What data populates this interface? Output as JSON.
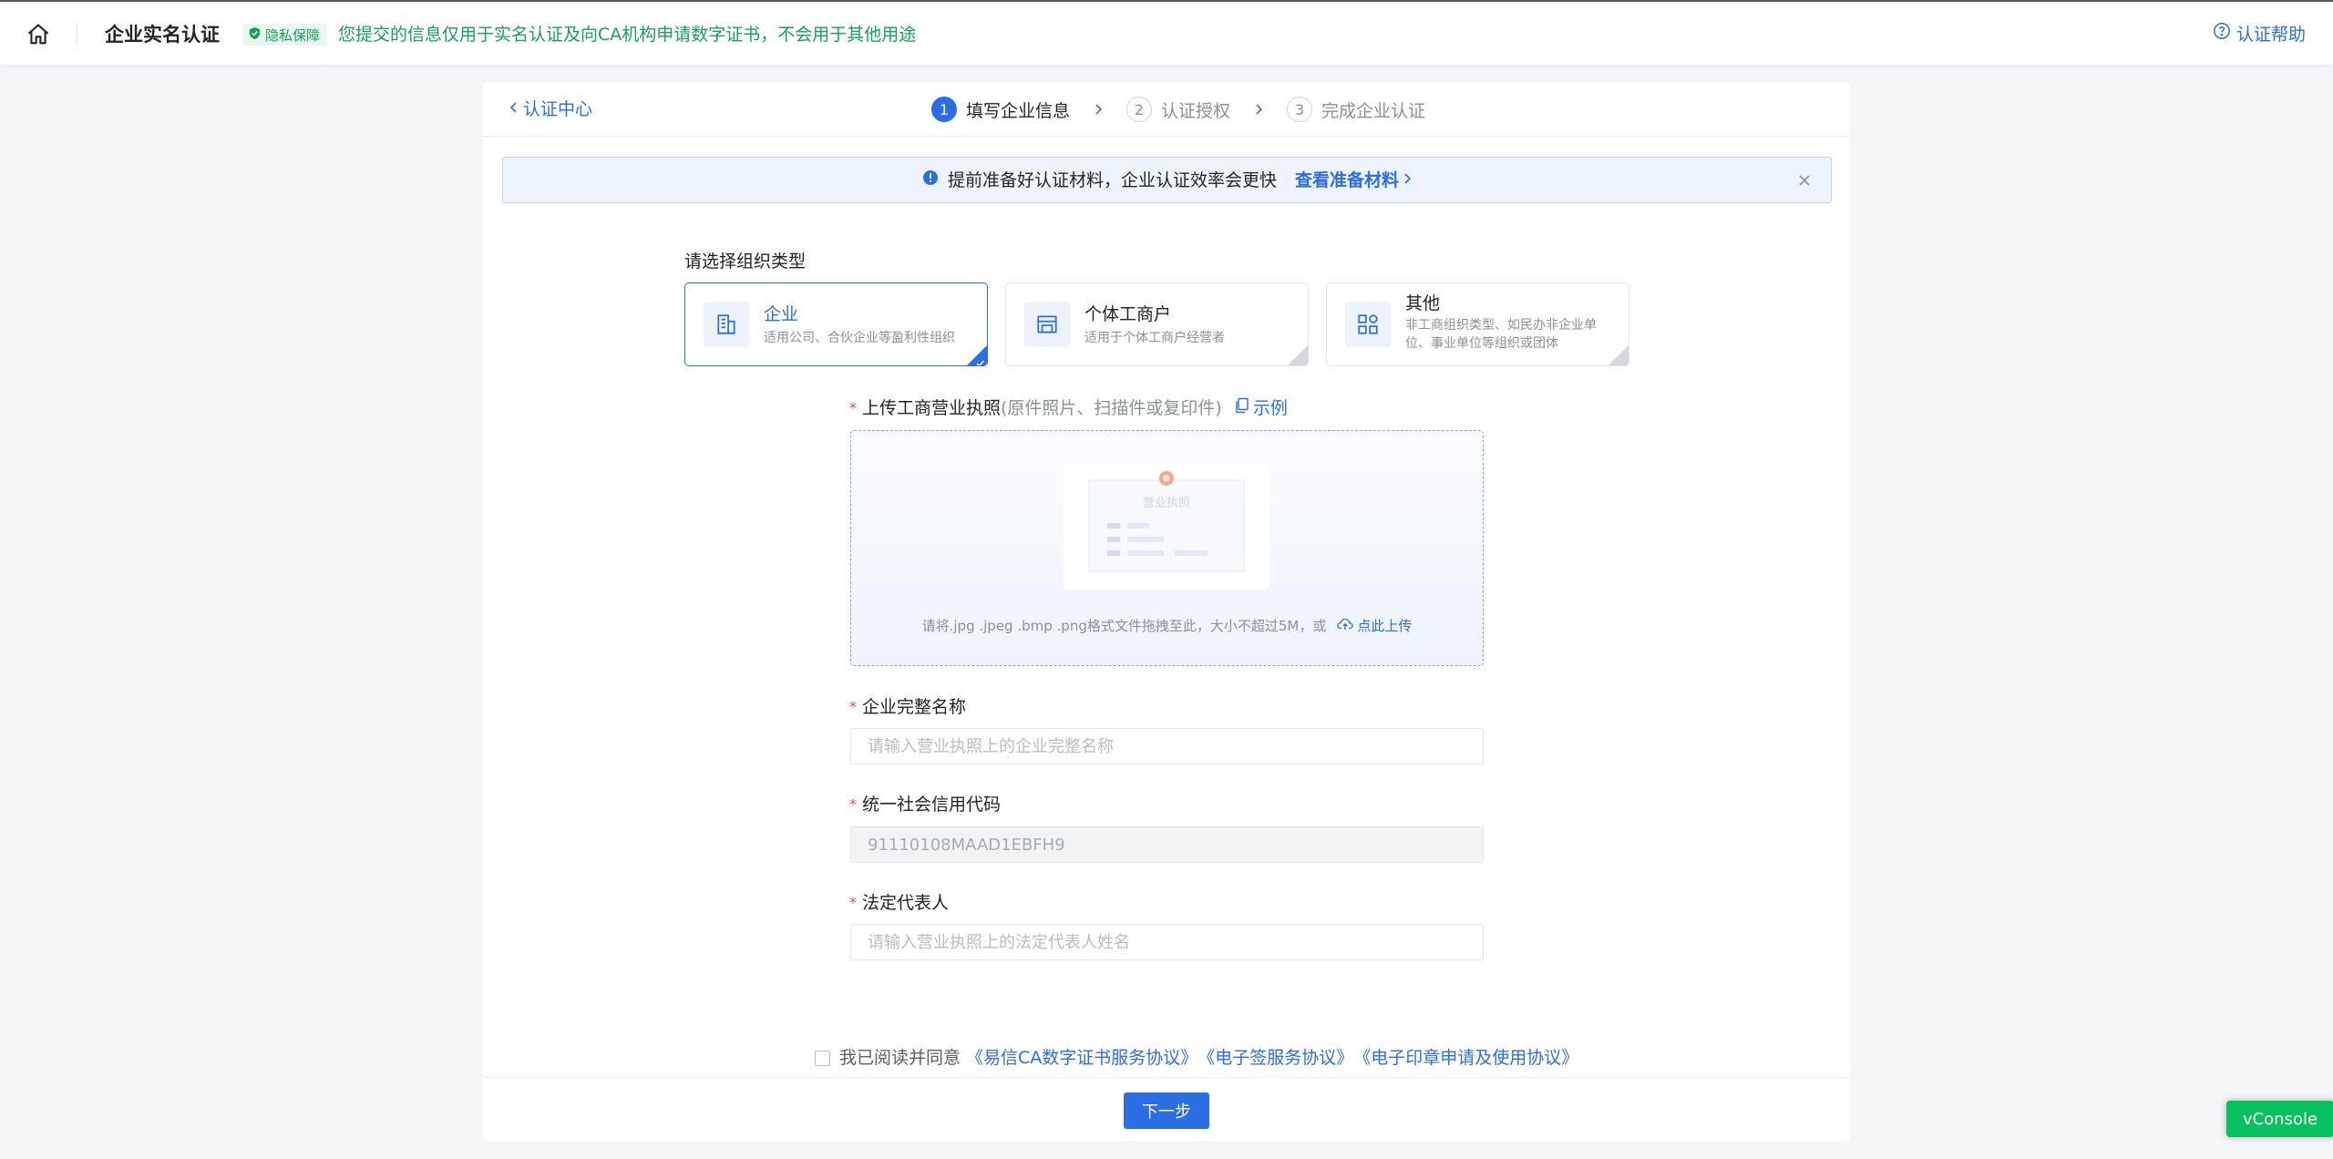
{
  "header": {
    "title": "企业实名认证",
    "privacy_badge": "隐私保障",
    "privacy_text": "您提交的信息仅用于实名认证及向CA机构申请数字证书，不会用于其他用途",
    "help_label": "认证帮助",
    "icons": [
      "home-icon",
      "shield-check-icon",
      "question-circle-icon"
    ]
  },
  "nav": {
    "back_label": "认证中心",
    "steps": [
      {
        "num": "1",
        "label": "填写企业信息",
        "active": true
      },
      {
        "num": "2",
        "label": "认证授权",
        "active": false
      },
      {
        "num": "3",
        "label": "完成企业认证",
        "active": false
      }
    ]
  },
  "notice": {
    "text": "提前准备好认证材料，企业认证效率会更快",
    "link": "查看准备材料"
  },
  "org_type": {
    "label": "请选择组织类型",
    "options": [
      {
        "title": "企业",
        "desc": "适用公司、合伙企业等盈利性组织",
        "selected": true
      },
      {
        "title": "个体工商户",
        "desc": "适用于个体工商户经营者",
        "selected": false
      },
      {
        "title": "其他",
        "desc": "非工商组织类型、如民办非企业单位、事业单位等组织或团体",
        "selected": false
      }
    ]
  },
  "upload": {
    "label": "上传工商营业执照",
    "label_hint": "(原件照片、扫描件或复印件)",
    "example": "示例",
    "illustration_title": "营业执照",
    "hint": "请将.jpg .jpeg .bmp .png格式文件拖拽至此，大小不超过5M，或",
    "upload_link": "点此上传"
  },
  "fields": {
    "company_name": {
      "label": "企业完整名称",
      "placeholder": "请输入营业执照上的企业完整名称",
      "value": ""
    },
    "credit_code": {
      "label": "统一社会信用代码",
      "placeholder": "",
      "value": "91110108MAAD1EBFH9"
    },
    "legal_rep": {
      "label": "法定代表人",
      "placeholder": "请输入营业执照上的法定代表人姓名",
      "value": ""
    }
  },
  "agreement": {
    "prefix": "我已阅读并同意",
    "links": [
      "《易信CA数字证书服务协议》",
      "《电子签服务协议》",
      "《电子印章申请及使用协议》"
    ]
  },
  "actions": {
    "next": "下一步"
  },
  "vconsole": "vConsole",
  "colors": {
    "primary": "#2b6de5",
    "success": "#18a058",
    "required": "#e34d59"
  }
}
